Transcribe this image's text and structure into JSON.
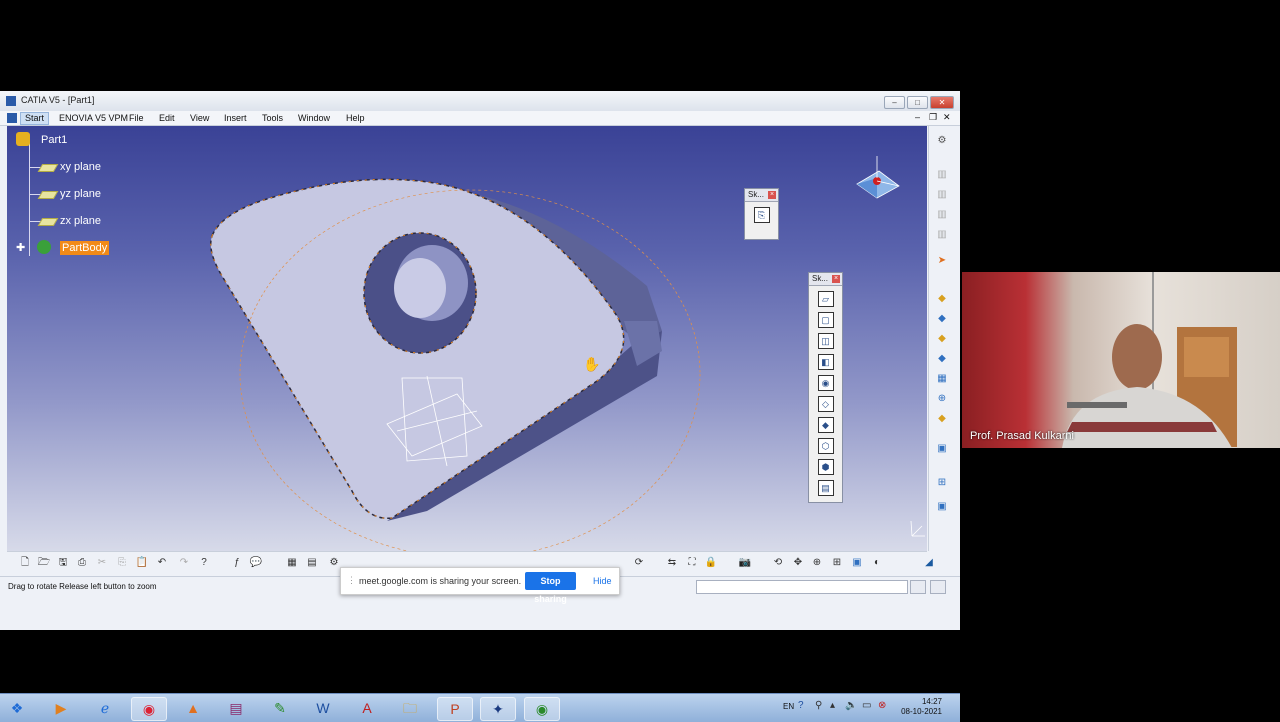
{
  "window": {
    "title": "CATIA V5 - [Part1]",
    "controls": [
      "–",
      "□",
      "✕"
    ]
  },
  "menubar": {
    "start": "Start",
    "items": [
      "ENOVIA V5 VPM",
      "File",
      "Edit",
      "View",
      "Insert",
      "Tools",
      "Window",
      "Help"
    ]
  },
  "tree": {
    "root": "Part1",
    "items": [
      {
        "label": "xy plane",
        "icon": "plane-icon"
      },
      {
        "label": "yz plane",
        "icon": "plane-icon"
      },
      {
        "label": "zx plane",
        "icon": "plane-icon"
      },
      {
        "label": "PartBody",
        "icon": "partbody-gear-icon",
        "selected": true
      }
    ]
  },
  "palettes": {
    "sketch_small": {
      "title": "Sk..."
    },
    "sketch_tools": {
      "title": "Sk..."
    }
  },
  "statusbar": {
    "message": "Drag to rotate  Release left button to zoom"
  },
  "screenshare": {
    "message": "meet.google.com is sharing your screen.",
    "stop": "Stop sharing",
    "hide": "Hide"
  },
  "taskbar": {
    "lang": "EN",
    "time": "14:27",
    "date": "08-10-2021"
  },
  "video": {
    "participant": "Prof. Prasad Kulkarni"
  },
  "colors": {
    "selection": "#f28a18",
    "viewport_top": "#3a4296",
    "viewport_bottom": "#d7dae9",
    "share_button": "#1a73e8"
  }
}
